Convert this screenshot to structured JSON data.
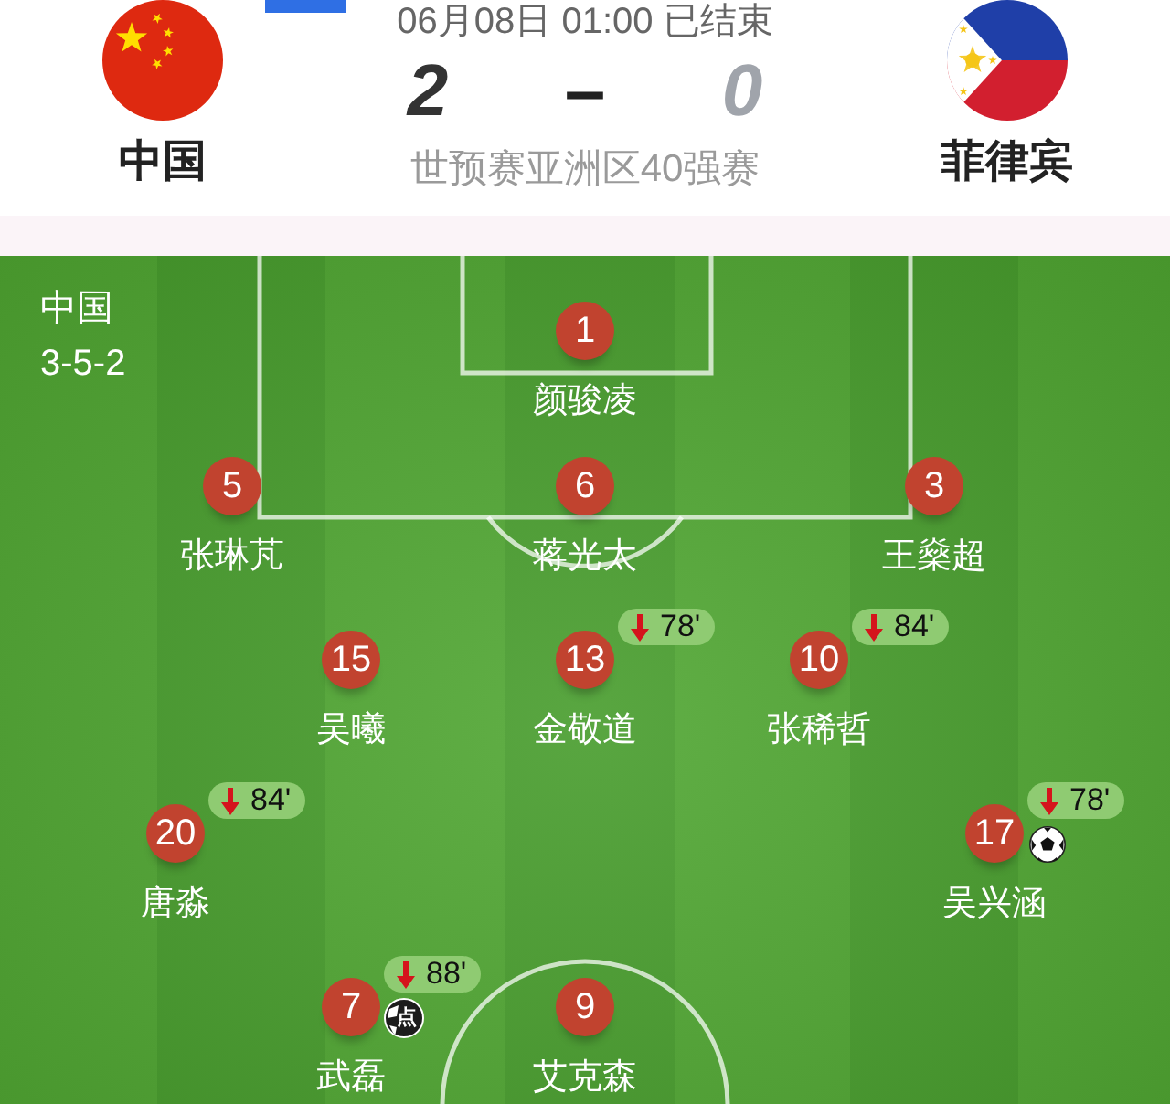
{
  "header": {
    "status": "06月08日 01:00 已结束",
    "home_team": {
      "name": "中国"
    },
    "away_team": {
      "name": "菲律宾"
    },
    "score": {
      "home": {
        "value": "2",
        "winning": true
      },
      "separator": "–",
      "away": {
        "value": "0",
        "winning": false
      }
    },
    "competition": "世预赛亚洲区40强赛"
  },
  "lineup": {
    "team": "中国",
    "formation": "3-5-2",
    "rows": [
      {
        "players": [
          {
            "number": "1",
            "name": "颜骏凌"
          }
        ]
      },
      {
        "players": [
          {
            "number": "5",
            "name": "张琳芃"
          },
          {
            "number": "6",
            "name": "蒋光太"
          },
          {
            "number": "3",
            "name": "王燊超"
          }
        ]
      },
      {
        "players": [
          {
            "number": "15",
            "name": "吴曦"
          },
          {
            "number": "13",
            "name": "金敬道",
            "substituted_out": "78'"
          },
          {
            "number": "10",
            "name": "张稀哲",
            "substituted_out": "84'"
          }
        ]
      },
      {
        "players": [
          {
            "number": "20",
            "name": "唐淼",
            "substituted_out": "84'"
          },
          {
            "number": "17",
            "name": "吴兴涵",
            "substituted_out": "78'",
            "goals": [
              {
                "kind": "goal"
              }
            ]
          }
        ]
      },
      {
        "players": [
          {
            "number": "7",
            "name": "武磊",
            "substituted_out": "88'",
            "goals": [
              {
                "kind": "penalty",
                "label": "点"
              }
            ]
          },
          {
            "number": "9",
            "name": "艾克森"
          }
        ]
      }
    ]
  }
}
